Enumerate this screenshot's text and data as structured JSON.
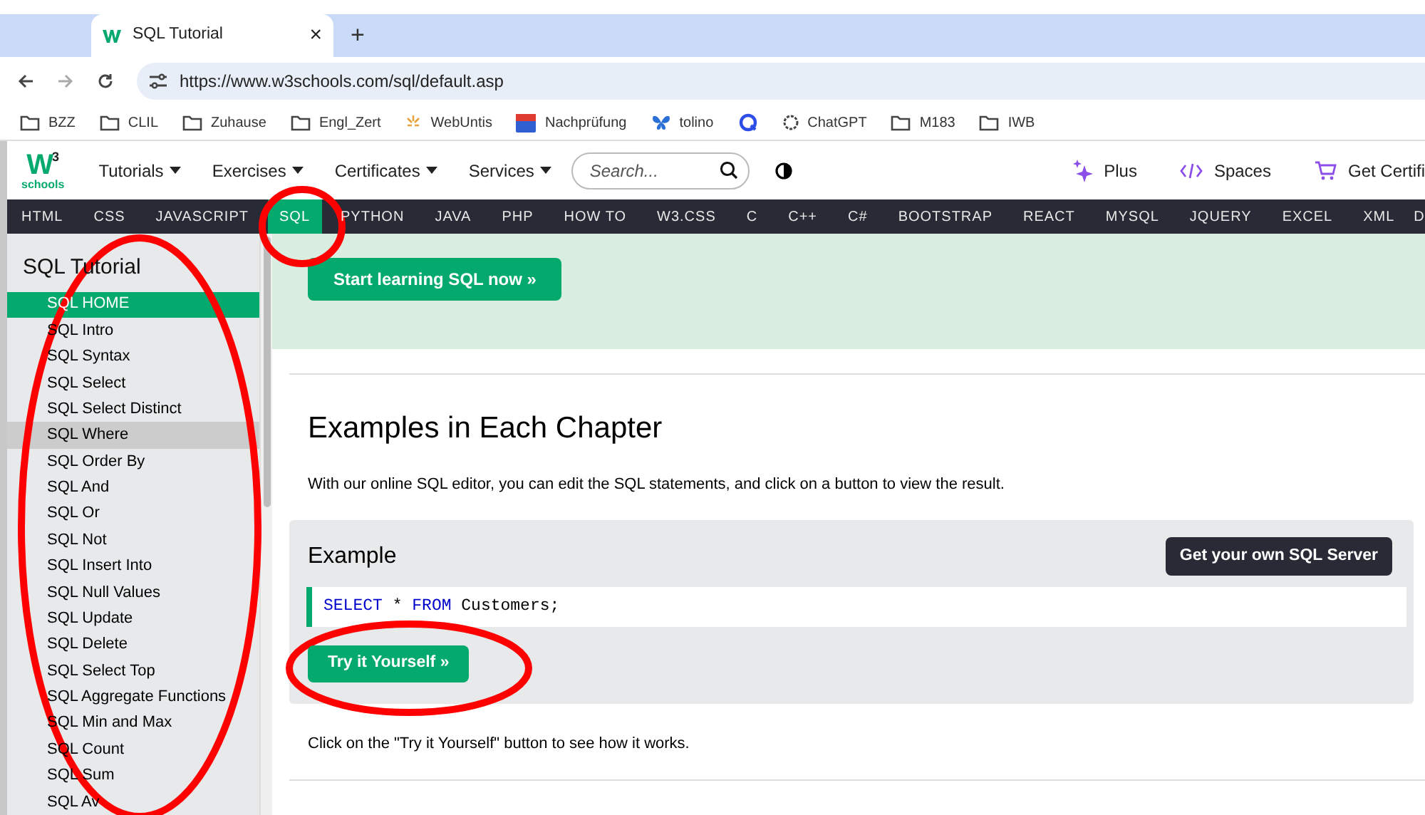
{
  "browser": {
    "tab_title": "SQL Tutorial",
    "tab_close": "×",
    "new_tab": "+",
    "url": "https://www.w3schools.com/sql/default.asp",
    "bookmarks": [
      {
        "label": "BZZ",
        "kind": "folder"
      },
      {
        "label": "CLIL",
        "kind": "folder"
      },
      {
        "label": "Zuhause",
        "kind": "folder"
      },
      {
        "label": "Engl_Zert",
        "kind": "folder"
      },
      {
        "label": "WebUntis",
        "kind": "spark"
      },
      {
        "label": "Nachprüfung",
        "kind": "badge"
      },
      {
        "label": "tolino",
        "kind": "butterfly"
      },
      {
        "kind": "q"
      },
      {
        "label": "ChatGPT",
        "kind": "gear"
      },
      {
        "label": "M183",
        "kind": "folder"
      },
      {
        "label": "IWB",
        "kind": "folder"
      }
    ]
  },
  "header": {
    "logo": {
      "mark": "W",
      "sup": "3",
      "word": "schools"
    },
    "menus": [
      "Tutorials",
      "Exercises",
      "Certificates",
      "Services"
    ],
    "search": {
      "placeholder": "Search..."
    },
    "links": [
      {
        "label": "Plus",
        "kind": "sparkle"
      },
      {
        "label": "Spaces",
        "kind": "code"
      },
      {
        "label": "Get Certifi",
        "kind": "cart"
      }
    ]
  },
  "topnav": [
    {
      "label": "HTML",
      "selected": false
    },
    {
      "label": "CSS",
      "selected": false
    },
    {
      "label": "JAVASCRIPT",
      "selected": false
    },
    {
      "label": "SQL",
      "selected": true
    },
    {
      "label": "PYTHON",
      "selected": false
    },
    {
      "label": "JAVA",
      "selected": false
    },
    {
      "label": "PHP",
      "selected": false
    },
    {
      "label": "HOW TO",
      "selected": false
    },
    {
      "label": "W3.CSS",
      "selected": false
    },
    {
      "label": "C",
      "selected": false
    },
    {
      "label": "C++",
      "selected": false
    },
    {
      "label": "C#",
      "selected": false
    },
    {
      "label": "BOOTSTRAP",
      "selected": false
    },
    {
      "label": "REACT",
      "selected": false
    },
    {
      "label": "MYSQL",
      "selected": false
    },
    {
      "label": "JQUERY",
      "selected": false
    },
    {
      "label": "EXCEL",
      "selected": false
    },
    {
      "label": "XML",
      "selected": false
    },
    {
      "label": "D",
      "selected": false
    }
  ],
  "sidebar": {
    "title": "SQL Tutorial",
    "items": [
      {
        "label": "SQL HOME",
        "selected": true,
        "hovered": false
      },
      {
        "label": "SQL Intro",
        "selected": false,
        "hovered": false
      },
      {
        "label": "SQL Syntax",
        "selected": false,
        "hovered": false
      },
      {
        "label": "SQL Select",
        "selected": false,
        "hovered": false
      },
      {
        "label": "SQL Select Distinct",
        "selected": false,
        "hovered": false
      },
      {
        "label": "SQL Where",
        "selected": false,
        "hovered": true
      },
      {
        "label": "SQL Order By",
        "selected": false,
        "hovered": false
      },
      {
        "label": "SQL And",
        "selected": false,
        "hovered": false
      },
      {
        "label": "SQL Or",
        "selected": false,
        "hovered": false
      },
      {
        "label": "SQL Not",
        "selected": false,
        "hovered": false
      },
      {
        "label": "SQL Insert Into",
        "selected": false,
        "hovered": false
      },
      {
        "label": "SQL Null Values",
        "selected": false,
        "hovered": false
      },
      {
        "label": "SQL Update",
        "selected": false,
        "hovered": false
      },
      {
        "label": "SQL Delete",
        "selected": false,
        "hovered": false
      },
      {
        "label": "SQL Select Top",
        "selected": false,
        "hovered": false
      },
      {
        "label": "SQL Aggregate Functions",
        "selected": false,
        "hovered": false
      },
      {
        "label": "SQL Min and Max",
        "selected": false,
        "hovered": false
      },
      {
        "label": "SQL Count",
        "selected": false,
        "hovered": false
      },
      {
        "label": "SQL Sum",
        "selected": false,
        "hovered": false
      },
      {
        "label": "SQL Av",
        "selected": false,
        "hovered": false
      }
    ]
  },
  "main": {
    "banner_button": "Start learning SQL now »",
    "heading": "Examples in Each Chapter",
    "intro": "With our online SQL editor, you can edit the SQL statements, and click on a button to view the result.",
    "example": {
      "title": "Example",
      "server_button": "Get your own SQL Server",
      "code": [
        {
          "text": "SELECT",
          "kind": "keyword"
        },
        {
          "text": " * ",
          "kind": "plain"
        },
        {
          "text": "FROM",
          "kind": "keyword"
        },
        {
          "text": " Customers;",
          "kind": "plain"
        }
      ],
      "try_button": "Try it Yourself »"
    },
    "note": "Click on the \"Try it Yourself\" button to see how it works."
  }
}
